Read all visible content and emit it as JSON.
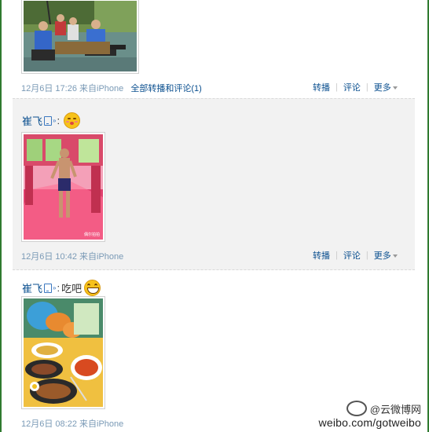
{
  "posts": [
    {
      "time": "12月6日 17:26",
      "source": "来自iPhone",
      "all_comments": "全部转播和评论(1)",
      "forward": "转播",
      "comment": "评论",
      "more": "更多"
    },
    {
      "author": "崔飞",
      "text": "",
      "time": "12月6日 10:42",
      "source": "来自iPhone",
      "forward": "转播",
      "comment": "评论",
      "more": "更多",
      "photo_caption": "偶尔拍拍"
    },
    {
      "author": "崔飞",
      "text": "吃吧",
      "time": "12月6日 08:22",
      "source": "来自iPhone"
    }
  ],
  "watermark": {
    "brand": "@云微博网",
    "url": "weibo.com/gotweibo"
  },
  "colors": {
    "link": "#0a4f8f",
    "meta": "#7a9ab6",
    "highlight_bg": "#f2f2f2",
    "frame": "#2f7a2f"
  }
}
